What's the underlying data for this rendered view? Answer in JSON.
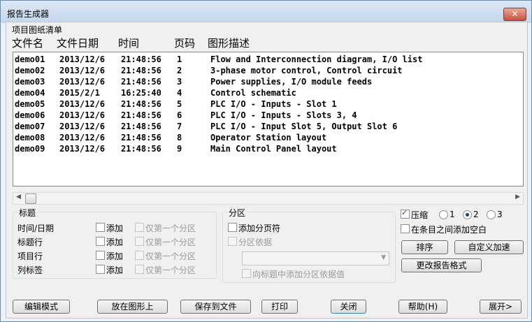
{
  "window": {
    "title": "报告生成器",
    "close_glyph": "✕"
  },
  "list": {
    "caption": "项目图纸清单",
    "headers": [
      "文件名",
      "文件日期",
      "时间",
      "页码",
      "图形描述"
    ],
    "rows": [
      [
        "demo01",
        "2013/12/6",
        "21:48:56",
        "1",
        "Flow and Interconnection diagram, I/O list"
      ],
      [
        "demo02",
        "2013/12/6",
        "21:48:56",
        "2",
        "3-phase motor control, Control circuit"
      ],
      [
        "demo03",
        "2013/12/6",
        "21:48:56",
        "3",
        "Power supplies, I/O module feeds"
      ],
      [
        "demo04",
        "2015/2/1",
        "16:25:40",
        "4",
        "Control schematic"
      ],
      [
        "demo05",
        "2013/12/6",
        "21:48:56",
        "5",
        "PLC I/O - Inputs - Slot 1"
      ],
      [
        "demo06",
        "2013/12/6",
        "21:48:56",
        "6",
        "PLC I/O - Inputs - Slots 3, 4"
      ],
      [
        "demo07",
        "2013/12/6",
        "21:48:56",
        "7",
        "PLC I/O - Input Slot 5, Output Slot 6"
      ],
      [
        "demo08",
        "2013/12/6",
        "21:48:56",
        "8",
        "Operator Station layout"
      ],
      [
        "demo09",
        "2013/12/6",
        "21:48:56",
        "9",
        "Main Control Panel layout"
      ]
    ]
  },
  "scrollbar": {
    "left_glyph": "◀",
    "right_glyph": "▶"
  },
  "titles_group": {
    "legend": "标题",
    "rows": [
      {
        "label": "时间/日期",
        "add": "添加",
        "first_only": "仅第一个分区"
      },
      {
        "label": "标题行",
        "add": "添加",
        "first_only": "仅第一个分区"
      },
      {
        "label": "项目行",
        "add": "添加",
        "first_only": "仅第一个分区"
      },
      {
        "label": "列标签",
        "add": "添加",
        "first_only": "仅第一个分区"
      }
    ]
  },
  "section_group": {
    "legend": "分区",
    "add_page_break": "添加分页符",
    "section_by": "分区依据",
    "combo_value": "",
    "combo_glyph": "▼",
    "add_to_title": "向标题中添加分区依据值"
  },
  "options": {
    "compress": "压缩",
    "compress_checked": true,
    "radios": [
      "1",
      "2",
      "3"
    ],
    "selected_radio": "2",
    "add_blank": "在条目之间添加空白",
    "sort_button": "排序",
    "custom_button": "自定义加速",
    "format_button": "更改报告格式"
  },
  "buttons": {
    "edit_mode": "编辑模式",
    "place": "放在图形上",
    "save": "保存到文件",
    "print": "打印",
    "close": "关闭",
    "help": "帮助(H)",
    "expand": "展开>"
  }
}
